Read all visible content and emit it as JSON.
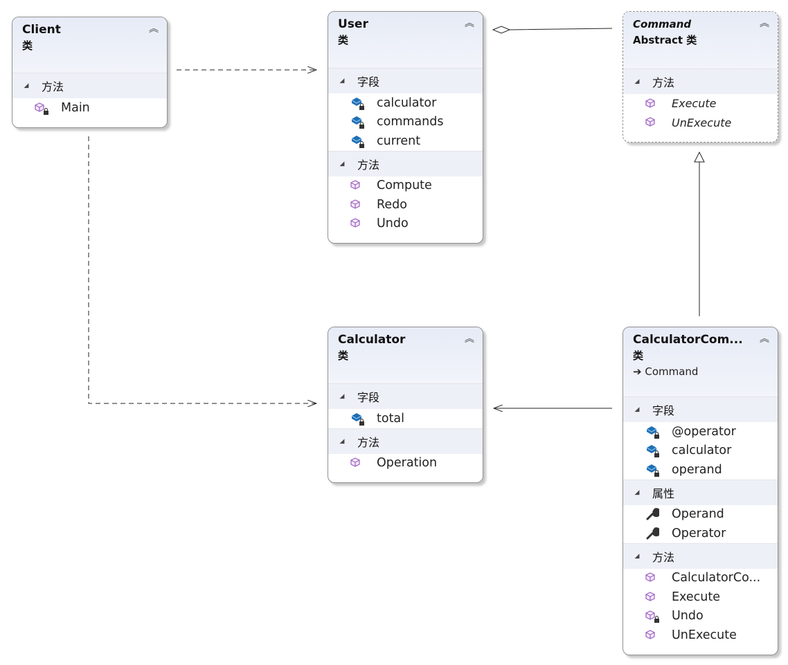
{
  "classes": [
    {
      "id": "client",
      "name": "Client",
      "kind": "类",
      "sections": [
        {
          "title": "方法",
          "items": [
            {
              "name": "Main",
              "icon": "method-private"
            }
          ]
        }
      ]
    },
    {
      "id": "user",
      "name": "User",
      "kind": "类",
      "sections": [
        {
          "title": "字段",
          "items": [
            {
              "name": "calculator",
              "icon": "field-private"
            },
            {
              "name": "commands",
              "icon": "field-private"
            },
            {
              "name": "current",
              "icon": "field-private"
            }
          ]
        },
        {
          "title": "方法",
          "items": [
            {
              "name": "Compute",
              "icon": "method"
            },
            {
              "name": "Redo",
              "icon": "method"
            },
            {
              "name": "Undo",
              "icon": "method"
            }
          ]
        }
      ]
    },
    {
      "id": "command",
      "name": "Command",
      "kind": "Abstract 类",
      "abstract": true,
      "sections": [
        {
          "title": "方法",
          "items": [
            {
              "name": "Execute",
              "icon": "method"
            },
            {
              "name": "UnExecute",
              "icon": "method"
            }
          ]
        }
      ]
    },
    {
      "id": "calculator",
      "name": "Calculator",
      "kind": "类",
      "sections": [
        {
          "title": "字段",
          "items": [
            {
              "name": "total",
              "icon": "field-private"
            }
          ]
        },
        {
          "title": "方法",
          "items": [
            {
              "name": "Operation",
              "icon": "method"
            }
          ]
        }
      ]
    },
    {
      "id": "calculator-command",
      "name": "CalculatorCom...",
      "kind": "类",
      "base": "Command",
      "sections": [
        {
          "title": "字段",
          "items": [
            {
              "name": "@operator",
              "icon": "field-private"
            },
            {
              "name": "calculator",
              "icon": "field-private"
            },
            {
              "name": "operand",
              "icon": "field-private"
            }
          ]
        },
        {
          "title": "属性",
          "items": [
            {
              "name": "Operand",
              "icon": "property"
            },
            {
              "name": "Operator",
              "icon": "property"
            }
          ]
        },
        {
          "title": "方法",
          "items": [
            {
              "name": "CalculatorCo...",
              "icon": "method"
            },
            {
              "name": "Execute",
              "icon": "method"
            },
            {
              "name": "Undo",
              "icon": "method-private"
            },
            {
              "name": "UnExecute",
              "icon": "method"
            }
          ]
        }
      ]
    }
  ],
  "icons": {
    "collapse": "double-chevron-up-icon",
    "section": "expanded-triangle-icon"
  },
  "colors": {
    "method": "#9b5fc0",
    "field": "#1e6fb5",
    "header": "#e6ebf6"
  }
}
